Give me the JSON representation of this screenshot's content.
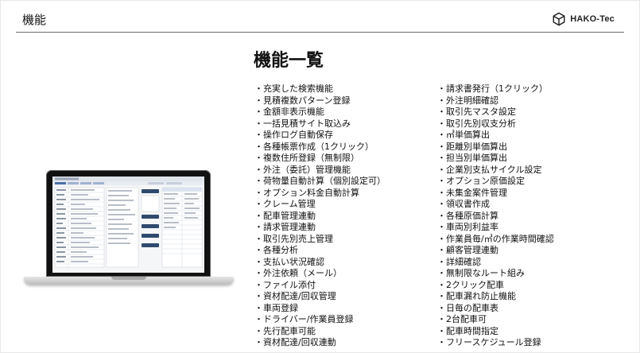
{
  "header": {
    "title": "機能",
    "logo_text": "HAKO-Tec",
    "logo_icon": "hexagon-cube-icon"
  },
  "main": {
    "title": "機能一覧",
    "left_items": [
      "・充実した検索機能",
      "・見積複数パターン登録",
      "・金額非表示機能",
      "・一括見積サイト取込み",
      "・操作ログ自動保存",
      "・各種帳票作成（1クリック）",
      "・複数住所登録（無制限）",
      "・外注（委託）管理機能",
      "・荷物量自動計算（個別設定可）",
      "・オプション料金自動計算",
      "・クレーム管理",
      "・配車管理連動",
      "・請求管理連動",
      "・取引先別売上管理",
      "・各種分析",
      "・支払い状況確認",
      "・外注依頼（メール）",
      "・ファイル添付",
      "・資材配達/回収管理",
      "・車両登録",
      "・ドライバー/作業員登録",
      "・先行配車可能",
      "・資材配達/回収連動"
    ],
    "right_items": [
      "・請求書発行（1クリック）",
      "・外注明細確認",
      "・取引先マスタ設定",
      "・取引先別収支分析",
      "・㎥単価算出",
      "・距離別単価算出",
      "・担当別単価算出",
      "・企業別支払サイクル設定",
      "・オプション原価設定",
      "・未集金案件管理",
      "・領収書作成",
      "・各種原価計算",
      "・車両別利益率",
      "・作業員毎/㎥の作業時間確認",
      "・顧客管理連動",
      "・詳細確認",
      "・無制限なルート組み",
      "・2クリック配車",
      "・配車漏れ防止機能",
      "・日毎の配車表",
      "・2台配車可",
      "・配車時間指定",
      "・フリースケジュール登録"
    ]
  },
  "illustration": {
    "device": "laptop-icon",
    "screen_content": "app-screenshot",
    "accent_color": "#2f4a6e",
    "tab_color": "#4a6fa5"
  }
}
